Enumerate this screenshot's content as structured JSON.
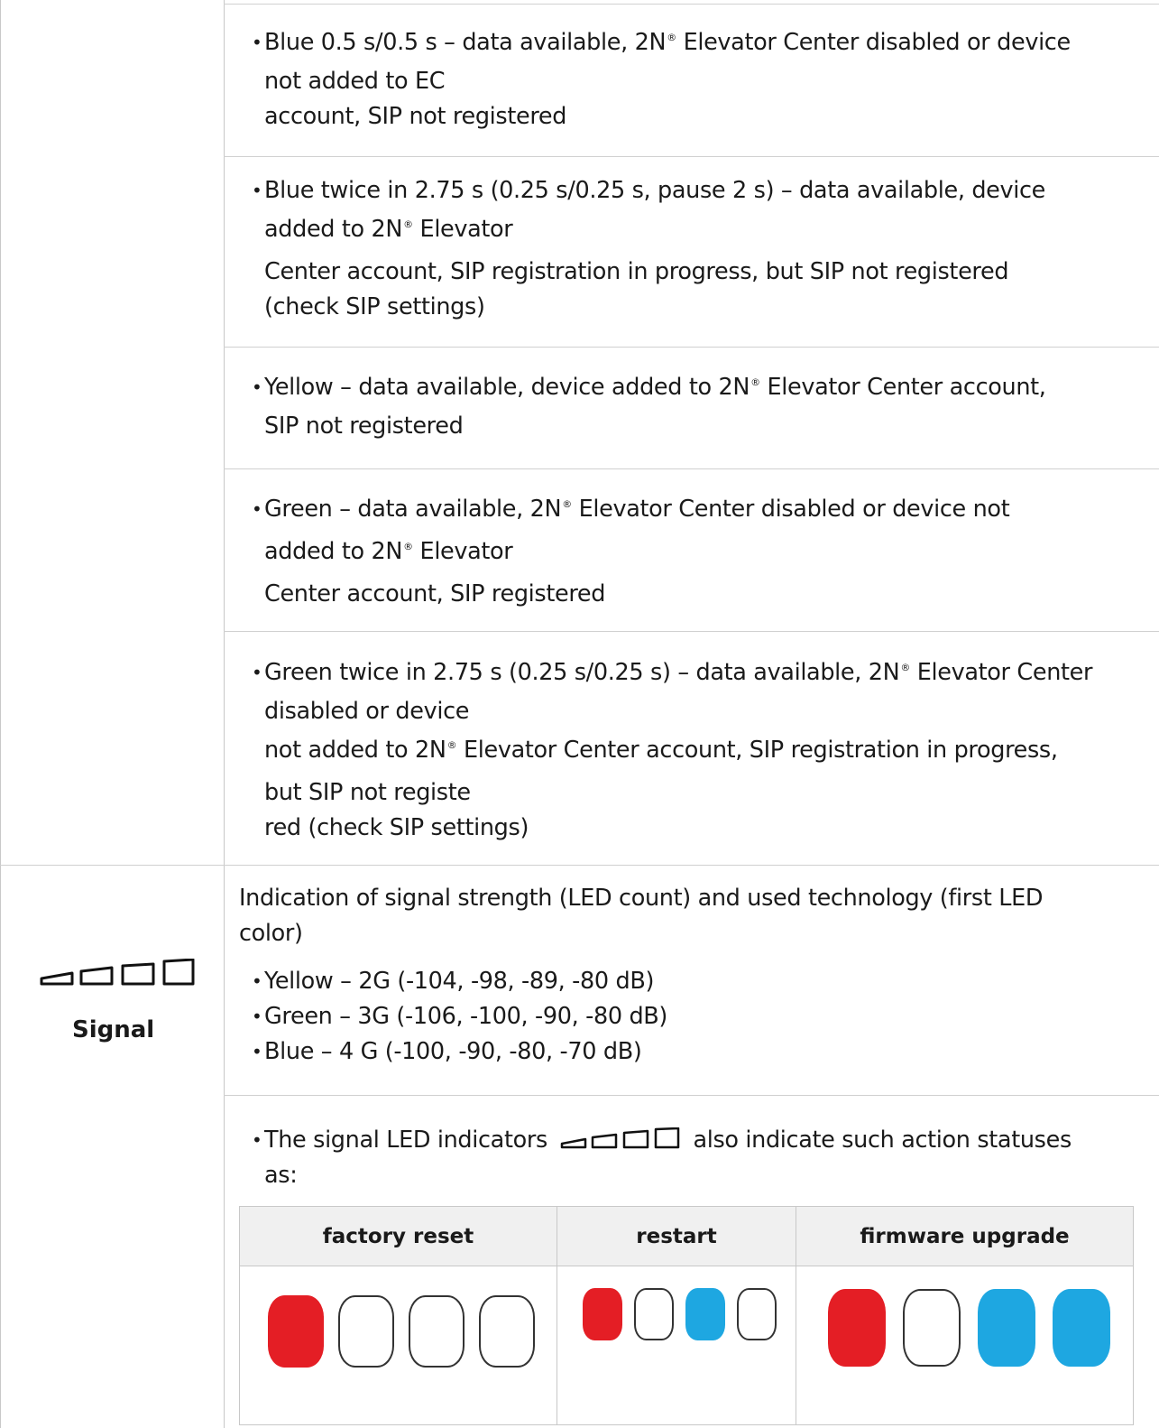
{
  "rows": [
    [
      "Blue 0.5 s/0.5 s – data available, 2N® Elevator Center disabled or device",
      "not added to EC",
      "account, SIP not registered"
    ],
    [
      "Blue twice in 2.75 s (0.25 s/0.25 s, pause 2 s) – data available, device",
      "added to 2N® Elevator",
      "Center account, SIP registration in progress, but SIP not registered",
      "(check SIP settings)"
    ],
    [
      "Yellow – data available, device added to 2N® Elevator Center account,",
      "SIP not registered"
    ],
    [
      "Green – data available, 2N® Elevator Center disabled or device not",
      "added to 2N® Elevator",
      "Center account, SIP registered"
    ],
    [
      "Green twice in 2.75 s (0.25 s/0.25 s) – data available, 2N® Elevator Center",
      "disabled or device",
      "not added to 2N® Elevator Center account, SIP registration in progress,",
      "but SIP not registe",
      "red (check SIP settings)"
    ]
  ],
  "signal": {
    "label": "Signal",
    "icon": "signal-strength-icon",
    "intro_1": "Indication of signal strength (LED count) and used technology (first LED",
    "intro_2": "color)",
    "items": [
      "Yellow – 2G (-104,  -98, -89, -80 dB)",
      "Green – 3G (-106, -100, -90, -80 dB)",
      "Blue – 4 G (-100,  -90, -80, -70 dB)"
    ],
    "actions_text_before": "The signal LED indicators",
    "actions_text_after": "also indicate such action statuses",
    "actions_text_2": "as:"
  },
  "status_table": {
    "headers": [
      "factory reset",
      "restart",
      "firmware upgrade"
    ],
    "colors": {
      "red": "#e41e25",
      "blue": "#1ea7e1",
      "off": "#ffffff"
    },
    "leds": {
      "factory_reset": [
        "red",
        "off",
        "off",
        "off"
      ],
      "restart": [
        "red",
        "off",
        "blue",
        "off"
      ],
      "firmware_upgrade": [
        "red",
        "off",
        "blue",
        "blue"
      ]
    }
  }
}
